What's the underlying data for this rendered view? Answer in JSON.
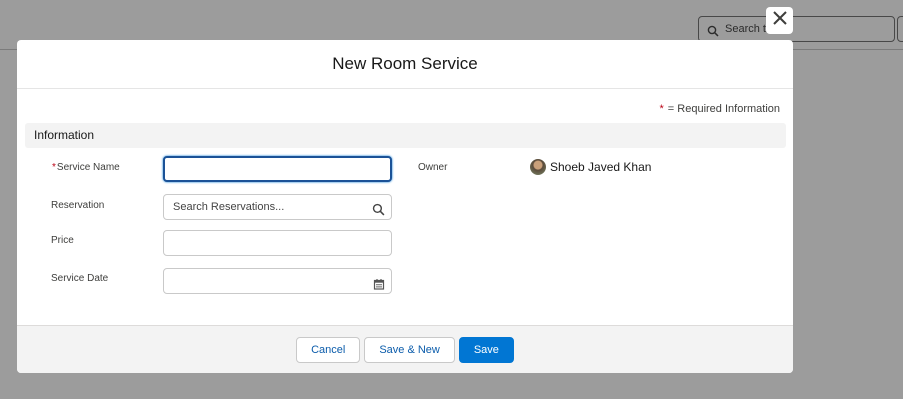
{
  "background": {
    "search_placeholder": "Search th..."
  },
  "modal": {
    "title": "New Room Service",
    "required_note": "= Required Information",
    "required_star": "*",
    "section_title": "Information",
    "fields": {
      "service_name": {
        "label": "Service Name",
        "required": true,
        "value": ""
      },
      "reservation": {
        "label": "Reservation",
        "placeholder": "Search Reservations..."
      },
      "price": {
        "label": "Price",
        "value": ""
      },
      "service_date": {
        "label": "Service Date",
        "value": ""
      }
    },
    "owner": {
      "label": "Owner",
      "name": "Shoeb Javed Khan"
    },
    "footer": {
      "cancel_label": "Cancel",
      "save_new_label": "Save & New",
      "save_label": "Save"
    }
  },
  "colors": {
    "brand": "#0176d3",
    "required": "#ba0517",
    "focus_border": "#1b5297"
  },
  "icons": [
    "close-icon",
    "search-icon",
    "calendar-icon",
    "avatar"
  ]
}
